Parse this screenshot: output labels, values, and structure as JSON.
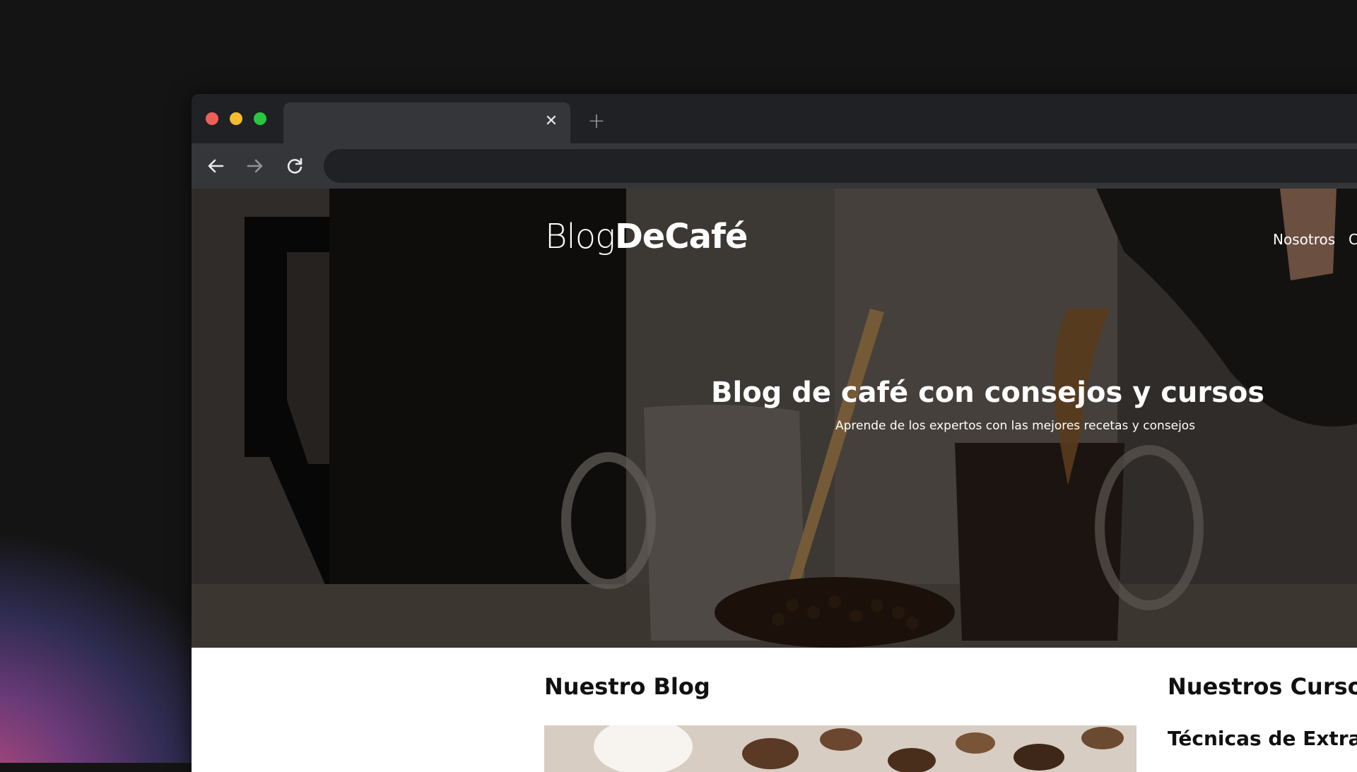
{
  "browser": {
    "tab_close_glyph": "✕",
    "new_tab_glyph": "+",
    "icons": {
      "back": "arrow-left-icon",
      "forward": "arrow-right-icon",
      "reload": "reload-icon",
      "close": "close-icon",
      "new_tab": "plus-icon"
    },
    "url": ""
  },
  "site": {
    "logo_light": "Blog",
    "logo_bold": "DeCafé",
    "nav": [
      "Nosotros",
      "C"
    ]
  },
  "hero": {
    "title": "Blog de café con consejos y cursos",
    "subtitle": "Aprende de los expertos con las mejores recetas y consejos"
  },
  "main": {
    "blog_heading": "Nuestro Blog",
    "courses_heading": "Nuestros Cursos y",
    "course_title": "Técnicas de Extracció"
  },
  "colors": {
    "traffic_red": "#ed5f57",
    "traffic_yellow": "#f4bd2e",
    "traffic_green": "#27c840",
    "toolbar": "#35363a",
    "titlebar": "#202124"
  }
}
